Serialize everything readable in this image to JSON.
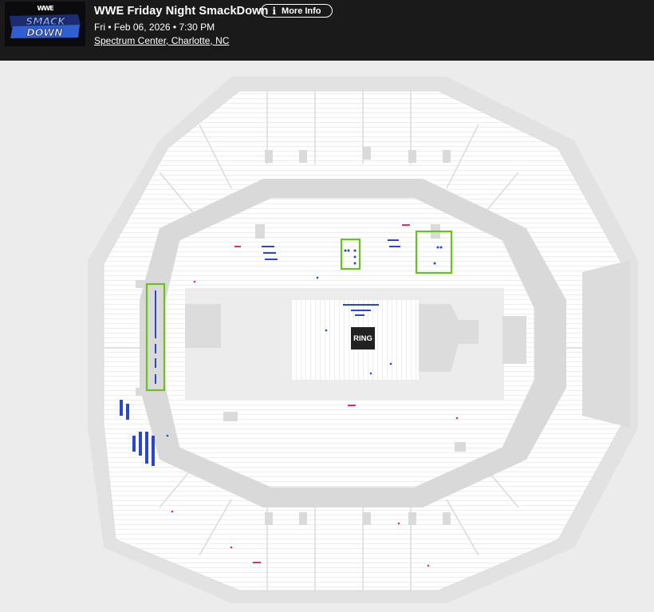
{
  "header": {
    "logo": {
      "brand": "WWE",
      "text": "SMACKDOWN"
    },
    "event_title": "WWE Friday Night SmackDown",
    "more_info_label": "More Info",
    "more_info_icon": "info-icon",
    "date_time": "Fri • Feb 06, 2026 • 7:30 PM",
    "venue": "Spectrum Center, Charlotte, NC",
    "background": "#1a1a1a"
  },
  "map": {
    "stage_label": "RING",
    "colors": {
      "background": "#ececec",
      "concourse": "#e2e2e2",
      "bowl": "#ffffff",
      "available_blue": "#2b47c9",
      "available_pink": "#d6336c",
      "highlight_green": "#6cc01c",
      "ring": "#222222"
    }
  }
}
